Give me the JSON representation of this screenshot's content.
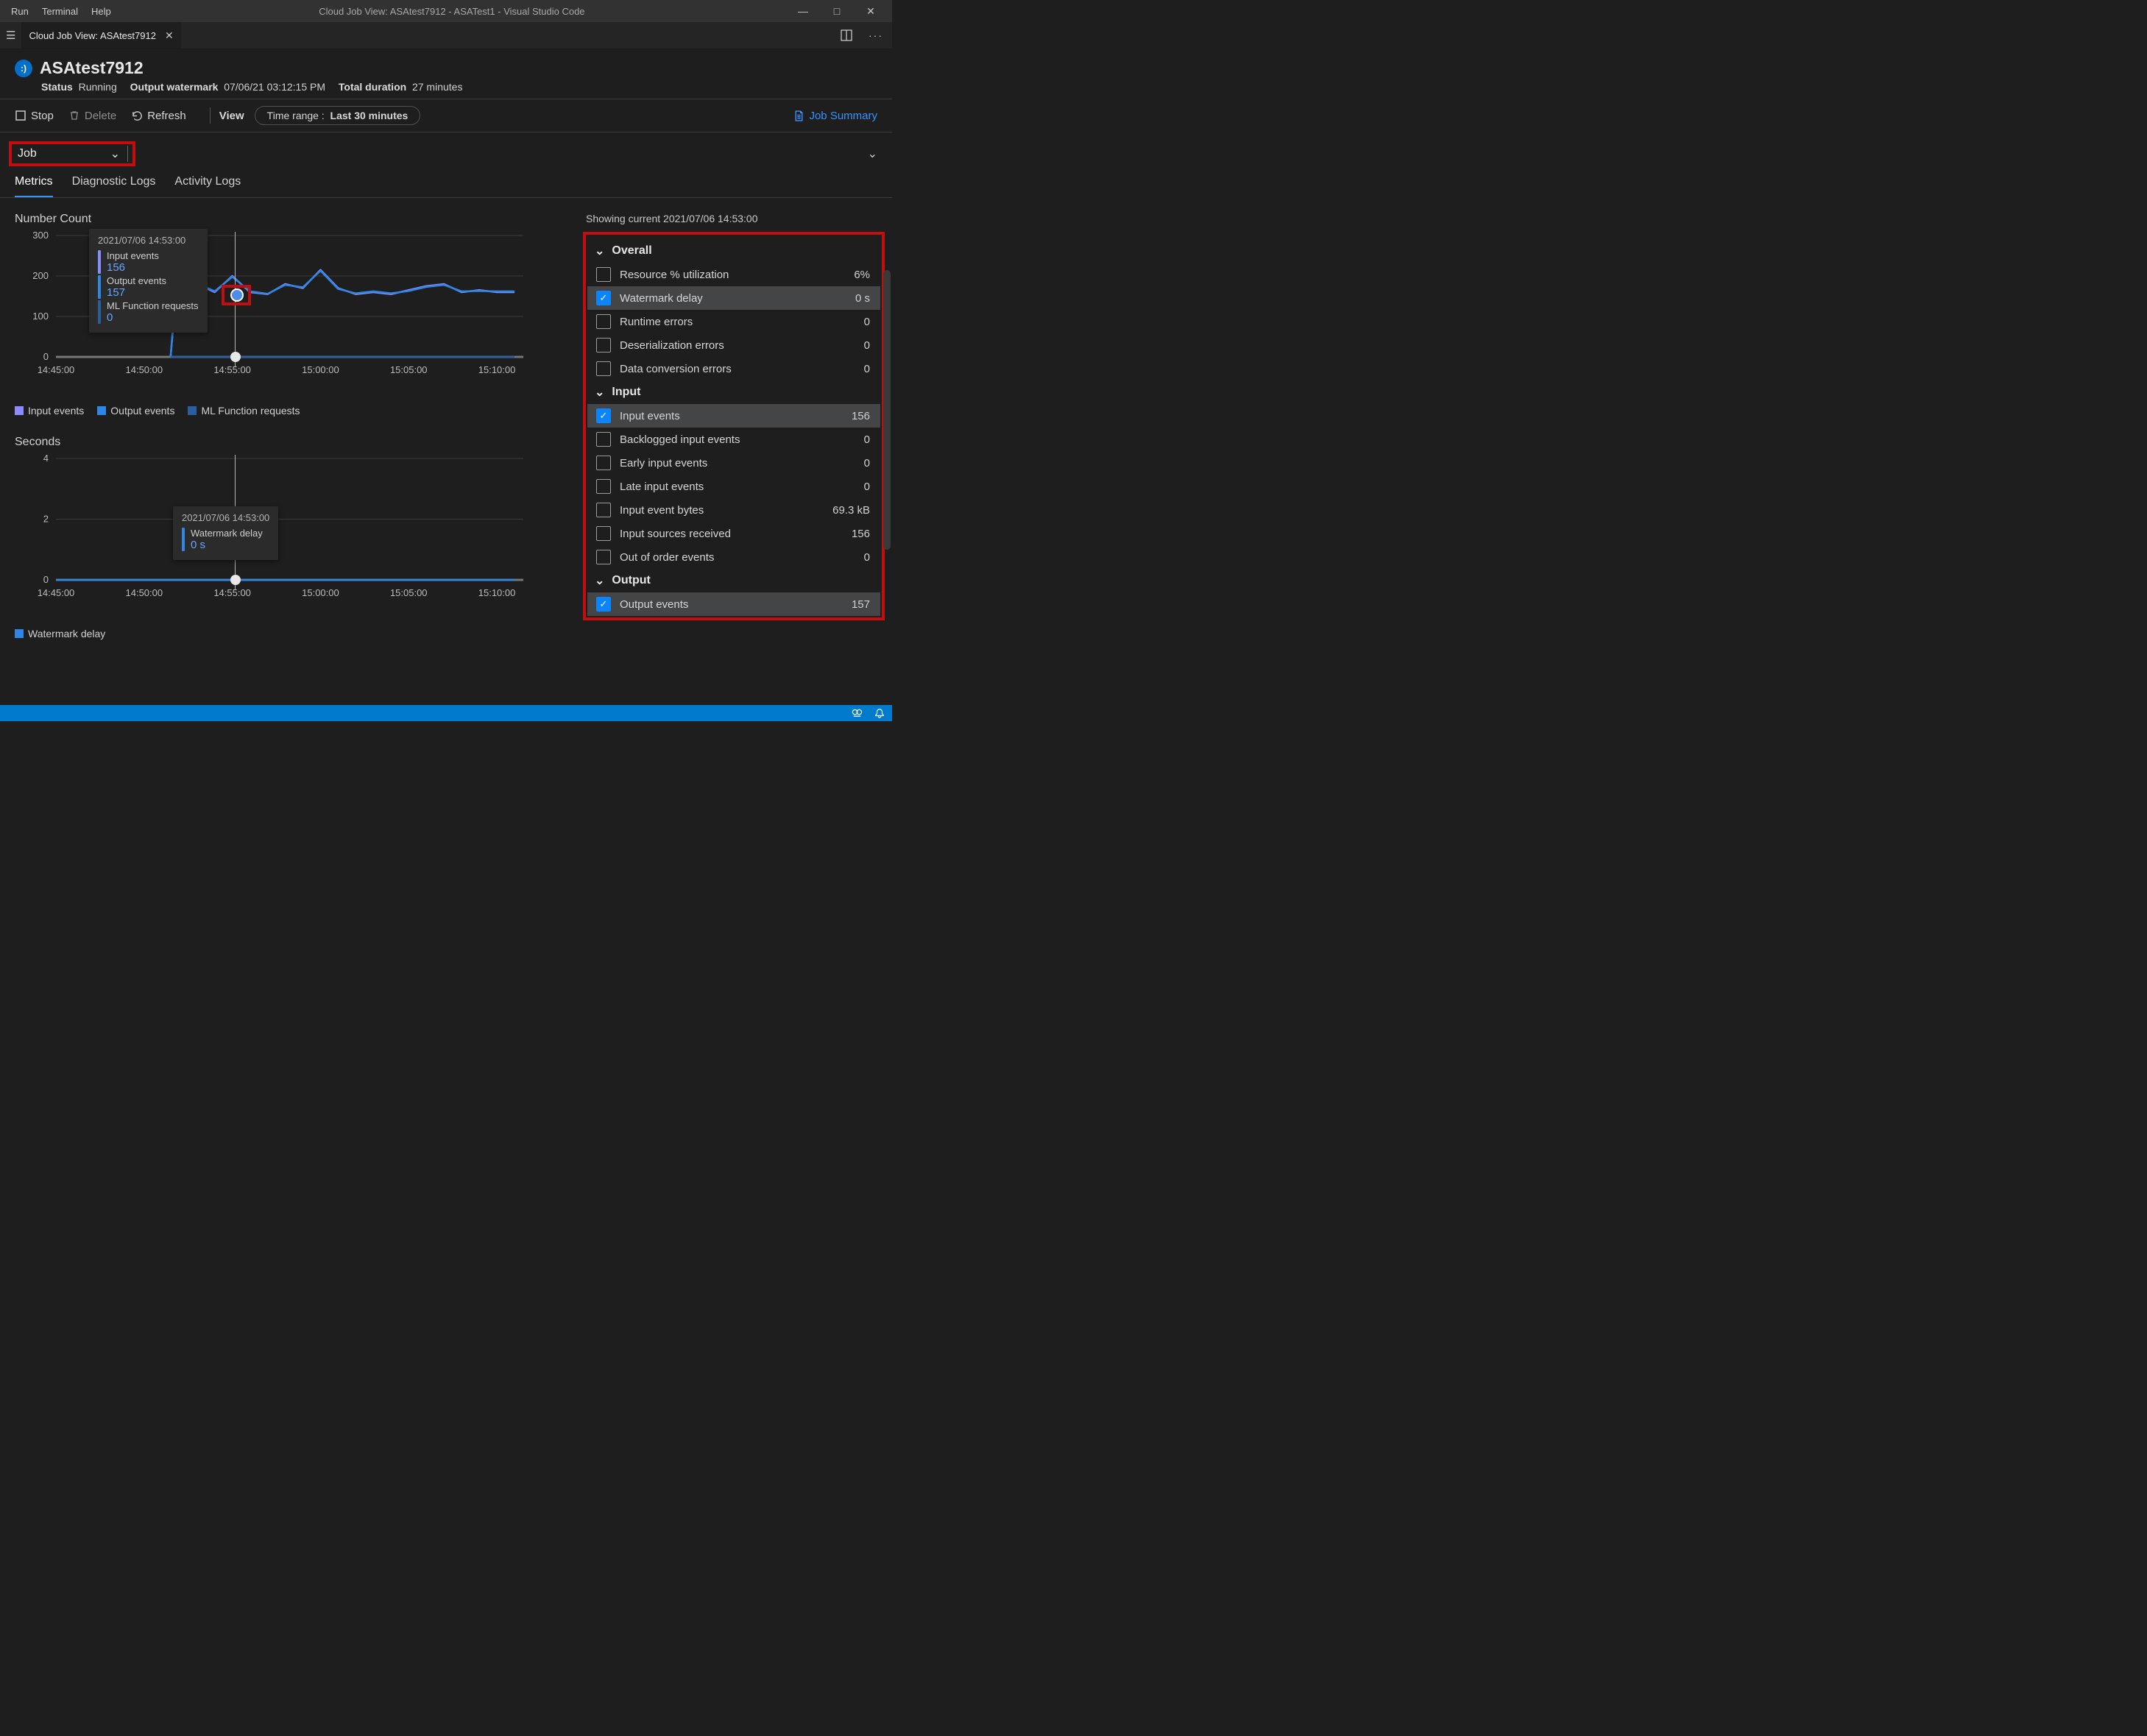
{
  "menu": {
    "run": "Run",
    "terminal": "Terminal",
    "help": "Help"
  },
  "window_title": "Cloud Job View: ASAtest7912 - ASATest1 - Visual Studio Code",
  "editor_tab": "Cloud Job View: ASAtest7912",
  "job": {
    "name": "ASAtest7912",
    "status_label": "Status",
    "status_value": "Running",
    "watermark_label": "Output watermark",
    "watermark_value": "07/06/21 03:12:15 PM",
    "duration_label": "Total duration",
    "duration_value": "27 minutes"
  },
  "toolbar": {
    "stop": "Stop",
    "delete": "Delete",
    "refresh": "Refresh",
    "view": "View",
    "timerange_label": "Time range :",
    "timerange_value": "Last 30 minutes",
    "job_summary": "Job Summary"
  },
  "scope_selector": "Job",
  "tabs": {
    "metrics": "Metrics",
    "diag": "Diagnostic Logs",
    "activity": "Activity Logs"
  },
  "showing_line": "Showing current 2021/07/06 14:53:00",
  "tooltip_ts": "2021/07/06 14:53:00",
  "tip1": {
    "in_label": "Input events",
    "in_val": "156",
    "out_label": "Output events",
    "out_val": "157",
    "ml_label": "ML Function requests",
    "ml_val": "0"
  },
  "tip2": {
    "wd_label": "Watermark delay",
    "wd_val": "0 s"
  },
  "legend": {
    "in": "Input events",
    "out": "Output events",
    "ml": "ML Function requests",
    "wd": "Watermark delay"
  },
  "groups": {
    "overall": "Overall",
    "input": "Input",
    "output": "Output"
  },
  "metrics": {
    "res_util": {
      "name": "Resource % utilization",
      "val": "6%",
      "checked": false
    },
    "wdelay": {
      "name": "Watermark delay",
      "val": "0 s",
      "checked": true
    },
    "rt_err": {
      "name": "Runtime errors",
      "val": "0",
      "checked": false
    },
    "deser": {
      "name": "Deserialization errors",
      "val": "0",
      "checked": false
    },
    "dconv": {
      "name": "Data conversion errors",
      "val": "0",
      "checked": false
    },
    "in_ev": {
      "name": "Input events",
      "val": "156",
      "checked": true
    },
    "backlog": {
      "name": "Backlogged input events",
      "val": "0",
      "checked": false
    },
    "early": {
      "name": "Early input events",
      "val": "0",
      "checked": false
    },
    "late": {
      "name": "Late input events",
      "val": "0",
      "checked": false
    },
    "in_bytes": {
      "name": "Input event bytes",
      "val": "69.3 kB",
      "checked": false
    },
    "in_src": {
      "name": "Input sources received",
      "val": "156",
      "checked": false
    },
    "ooo": {
      "name": "Out of order events",
      "val": "0",
      "checked": false
    },
    "out_ev": {
      "name": "Output events",
      "val": "157",
      "checked": true
    }
  },
  "chart_data": [
    {
      "type": "line",
      "title": "Number Count",
      "xlabel": "",
      "ylabel": "",
      "ylim": [
        0,
        300
      ],
      "x_ticks": [
        "14:45:00",
        "14:50:00",
        "14:55:00",
        "15:00:00",
        "15:05:00",
        "15:10:00"
      ],
      "y_ticks": [
        0,
        100,
        200,
        300
      ],
      "cursor_x": "14:53:00",
      "series": [
        {
          "name": "Input events",
          "color": "#8a8cff",
          "x": [
            "14:51:30",
            "14:52:00",
            "14:52:30",
            "14:53:00",
            "14:53:30",
            "14:54:00",
            "14:55:00",
            "14:56:00",
            "14:57:00",
            "14:58:00",
            "14:59:00",
            "15:00:00",
            "15:01:00",
            "15:02:00",
            "15:03:00",
            "15:04:00",
            "15:05:00",
            "15:06:00",
            "15:07:00",
            "15:08:00",
            "15:09:00",
            "15:10:00",
            "15:11:00"
          ],
          "values": [
            0,
            260,
            160,
            156,
            170,
            160,
            200,
            160,
            155,
            180,
            170,
            215,
            170,
            155,
            160,
            155,
            165,
            175,
            180,
            160,
            165,
            160,
            160
          ]
        },
        {
          "name": "Output events",
          "color": "#2f86e5",
          "x": [
            "14:51:30",
            "14:52:00",
            "14:52:30",
            "14:53:00",
            "14:53:30",
            "14:54:00",
            "14:55:00",
            "14:56:00",
            "14:57:00",
            "14:58:00",
            "14:59:00",
            "15:00:00",
            "15:01:00",
            "15:02:00",
            "15:03:00",
            "15:04:00",
            "15:05:00",
            "15:06:00",
            "15:07:00",
            "15:08:00",
            "15:09:00",
            "15:10:00",
            "15:11:00"
          ],
          "values": [
            0,
            258,
            158,
            157,
            172,
            162,
            198,
            162,
            156,
            178,
            172,
            213,
            168,
            157,
            162,
            157,
            163,
            173,
            178,
            162,
            163,
            162,
            162
          ]
        },
        {
          "name": "ML Function requests",
          "color": "#2b5ea0",
          "x": [
            "14:51:30",
            "15:11:00"
          ],
          "values": [
            0,
            0
          ]
        }
      ]
    },
    {
      "type": "line",
      "title": "Seconds",
      "xlabel": "",
      "ylabel": "",
      "ylim": [
        0,
        4
      ],
      "x_ticks": [
        "14:45:00",
        "14:50:00",
        "14:55:00",
        "15:00:00",
        "15:05:00",
        "15:10:00"
      ],
      "y_ticks": [
        0,
        2,
        4
      ],
      "cursor_x": "14:53:00",
      "series": [
        {
          "name": "Watermark delay",
          "color": "#2f86e5",
          "x": [
            "14:45:00",
            "15:11:00"
          ],
          "values": [
            0,
            0
          ]
        }
      ]
    }
  ]
}
